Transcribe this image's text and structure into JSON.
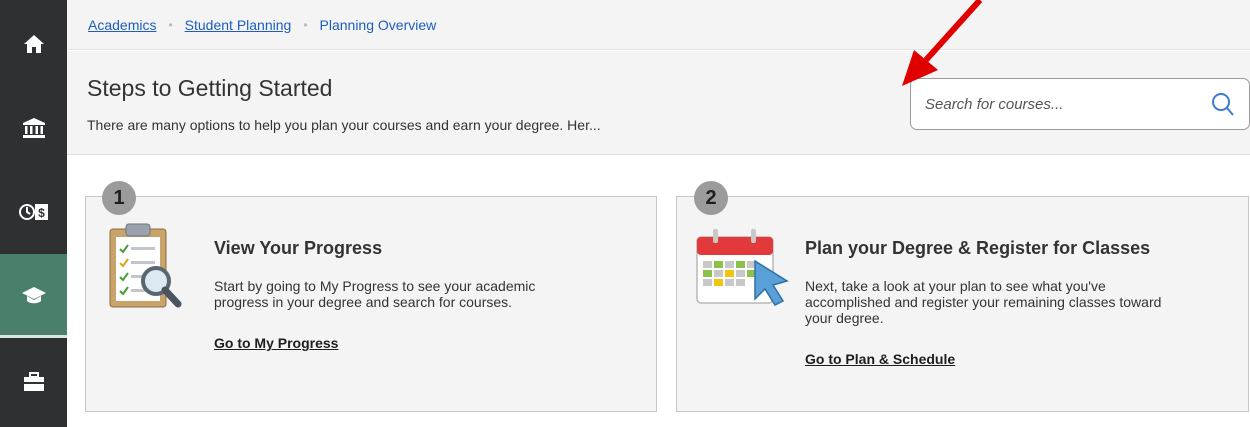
{
  "breadcrumb": {
    "items": [
      "Academics",
      "Student Planning"
    ],
    "current": "Planning Overview"
  },
  "header": {
    "title": "Steps to Getting Started",
    "subtitle": "There are many options to help you plan your courses and earn your degree. Her..."
  },
  "search": {
    "placeholder": "Search for courses..."
  },
  "nav": {
    "items": [
      {
        "icon": "home-icon"
      },
      {
        "icon": "bank-icon"
      },
      {
        "icon": "time-finance-icon"
      },
      {
        "icon": "graduation-cap-icon",
        "active": true
      },
      {
        "icon": "briefcase-icon"
      }
    ]
  },
  "steps": [
    {
      "number": "1",
      "title": "View Your Progress",
      "text_line1": "Start by going to My Progress to see your academic",
      "text_line2": "progress in your degree and search for courses.",
      "link": "Go to My Progress",
      "icon": "clipboard-magnifier-icon"
    },
    {
      "number": "2",
      "title": "Plan your Degree & Register for Classes",
      "text_line1": "Next, take a look at your plan to see what you've",
      "text_line2": "accomplished and register your remaining classes toward",
      "text_line3": "your degree.",
      "link": "Go to Plan & Schedule",
      "icon": "calendar-cursor-icon"
    }
  ],
  "colors": {
    "rail": "#2f3031",
    "rail_active": "#4a7f6a",
    "link": "#1d5dbd",
    "annotation_arrow": "#e00000"
  }
}
